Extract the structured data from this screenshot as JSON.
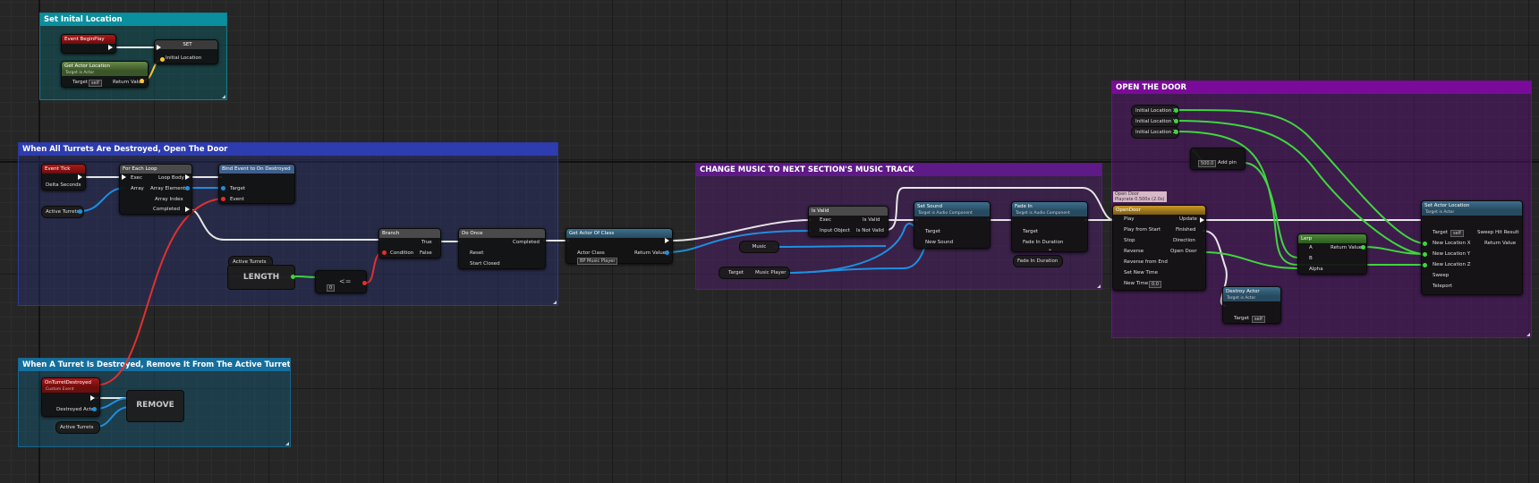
{
  "comments": {
    "initial_location": "Set Inital Location",
    "turrets_destroyed": "When All Turrets Are Destroyed, Open The Door",
    "turret_removed": "When A Turret Is Destroyed, Remove It From The Active Turrets Array",
    "change_music": "CHANGE MUSIC TO NEXT SECTION'S MUSIC TRACK",
    "open_door": "OPEN THE DOOR"
  },
  "colors": {
    "exec_wire": "#e6e6e6",
    "object_wire": "#1e8fe0",
    "vector_wire": "#ffc83a",
    "float_wire": "#3ed63e",
    "delegate_wire": "#e03030",
    "comment_teal": "#0a8f9e",
    "comment_blue": "#2d3db0",
    "comment_cyan": "#146f9e",
    "comment_purple": "#5e1a86",
    "comment_violet": "#7a0b9a"
  },
  "nodes": {
    "begin_play": {
      "title": "Event BeginPlay"
    },
    "set_var": {
      "title": "SET",
      "pin": "Initial Location"
    },
    "get_actor_location": {
      "title": "Get Actor Location",
      "subtitle": "Target is Actor",
      "target": "Target",
      "self": "self",
      "return": "Return Value"
    },
    "event_tick": {
      "title": "Event Tick",
      "delta": "Delta Seconds"
    },
    "active_turrets_1": {
      "label": "Active Turrets"
    },
    "for_each": {
      "title": "For Each Loop",
      "exec": "Exec",
      "array": "Array",
      "loop_body": "Loop Body",
      "array_element": "Array Element",
      "array_index": "Array Index",
      "completed": "Completed"
    },
    "bind_event": {
      "title": "Bind Event to On Destroyed",
      "target": "Target",
      "event": "Event"
    },
    "active_turrets_2": {
      "label": "Active Turrets"
    },
    "length": {
      "label": "LENGTH"
    },
    "lte": {
      "label": "<=",
      "value": "0"
    },
    "branch": {
      "title": "Branch",
      "condition": "Condition",
      "true": "True",
      "false": "False"
    },
    "do_once": {
      "title": "Do Once",
      "reset": "Reset",
      "start_closed": "Start Closed",
      "completed": "Completed"
    },
    "get_actor_of_class": {
      "title": "Get Actor Of Class",
      "actor_class": "Actor Class",
      "class_value": "BP Music Player",
      "return": "Return Value"
    },
    "is_valid": {
      "title": "Is Valid",
      "exec": "Exec",
      "input_object": "Input Object",
      "is_valid": "Is Valid",
      "is_not_valid": "Is Not Valid"
    },
    "music": {
      "label": "Music"
    },
    "music_player_get": {
      "target": "Target",
      "music_player": "Music Player"
    },
    "set_sound": {
      "title": "Set Sound",
      "subtitle": "Target is Audio Component",
      "target": "Target",
      "new_sound": "New Sound"
    },
    "fade_in": {
      "title": "Fade In",
      "subtitle": "Target is Audio Component",
      "target": "Target",
      "fade_in_duration": "Fade In Duration"
    },
    "fade_in_duration_var": {
      "label": "Fade In Duration"
    },
    "initial_x": {
      "label": "Initial Location X"
    },
    "initial_y": {
      "label": "Initial Location Y"
    },
    "initial_z": {
      "label": "Initial Location Z"
    },
    "add": {
      "value": "500.0",
      "add_pin": "Add pin"
    },
    "timeline": {
      "comment": "Open Door",
      "comment2": "Playrate 0.500x (2.0s)",
      "title": "OpenDoor",
      "play": "Play",
      "play_from_start": "Play from Start",
      "stop": "Stop",
      "reverse": "Reverse",
      "reverse_from_end": "Reverse from End",
      "set_new_time": "Set New Time",
      "new_time": "New Time",
      "new_time_value": "0.0",
      "update": "Update",
      "finished": "Finished",
      "direction": "Direction",
      "open_door": "Open Door"
    },
    "lerp": {
      "title": "Lerp",
      "a": "A",
      "b": "B",
      "alpha": "Alpha",
      "return": "Return Value"
    },
    "destroy_actor": {
      "title": "Destroy Actor",
      "subtitle": "Target is Actor",
      "target": "Target",
      "self": "self"
    },
    "set_actor_location": {
      "title": "Set Actor Location",
      "subtitle": "Target is Actor",
      "target": "Target",
      "self": "self",
      "x": "New Location X",
      "y": "New Location Y",
      "z": "New Location Z",
      "sweep": "Sweep",
      "teleport": "Teleport",
      "sweep_hit": "Sweep Hit Result",
      "return": "Return Value"
    },
    "on_turret_destroyed": {
      "title": "OnTurretDestroyed",
      "subtitle": "Custom Event",
      "destroyed_actor": "Destroyed Actor"
    },
    "active_turrets_3": {
      "label": "Active Turrets"
    },
    "remove": {
      "label": "REMOVE"
    }
  }
}
